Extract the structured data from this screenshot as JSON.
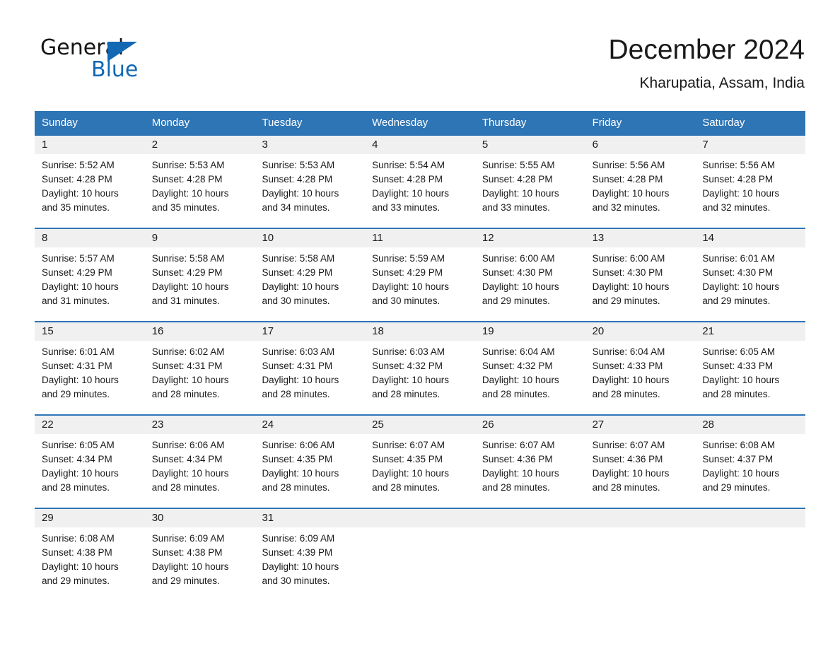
{
  "brand": {
    "word1": "General",
    "word2": "Blue",
    "triangle_color": "#1268b3",
    "text_color": "#161616"
  },
  "header": {
    "title": "December 2024",
    "subtitle": "Kharupatia, Assam, India"
  },
  "theme": {
    "header_blue": "#2e75b6",
    "date_band_gray": "#f0f0f0",
    "text_black": "#1a1a1a",
    "white": "#ffffff"
  },
  "weekdays": [
    "Sunday",
    "Monday",
    "Tuesday",
    "Wednesday",
    "Thursday",
    "Friday",
    "Saturday"
  ],
  "weeks": [
    {
      "days": [
        {
          "num": "1",
          "sunrise": "Sunrise: 5:52 AM",
          "sunset": "Sunset: 4:28 PM",
          "daylight1": "Daylight: 10 hours",
          "daylight2": "and 35 minutes."
        },
        {
          "num": "2",
          "sunrise": "Sunrise: 5:53 AM",
          "sunset": "Sunset: 4:28 PM",
          "daylight1": "Daylight: 10 hours",
          "daylight2": "and 35 minutes."
        },
        {
          "num": "3",
          "sunrise": "Sunrise: 5:53 AM",
          "sunset": "Sunset: 4:28 PM",
          "daylight1": "Daylight: 10 hours",
          "daylight2": "and 34 minutes."
        },
        {
          "num": "4",
          "sunrise": "Sunrise: 5:54 AM",
          "sunset": "Sunset: 4:28 PM",
          "daylight1": "Daylight: 10 hours",
          "daylight2": "and 33 minutes."
        },
        {
          "num": "5",
          "sunrise": "Sunrise: 5:55 AM",
          "sunset": "Sunset: 4:28 PM",
          "daylight1": "Daylight: 10 hours",
          "daylight2": "and 33 minutes."
        },
        {
          "num": "6",
          "sunrise": "Sunrise: 5:56 AM",
          "sunset": "Sunset: 4:28 PM",
          "daylight1": "Daylight: 10 hours",
          "daylight2": "and 32 minutes."
        },
        {
          "num": "7",
          "sunrise": "Sunrise: 5:56 AM",
          "sunset": "Sunset: 4:28 PM",
          "daylight1": "Daylight: 10 hours",
          "daylight2": "and 32 minutes."
        }
      ]
    },
    {
      "days": [
        {
          "num": "8",
          "sunrise": "Sunrise: 5:57 AM",
          "sunset": "Sunset: 4:29 PM",
          "daylight1": "Daylight: 10 hours",
          "daylight2": "and 31 minutes."
        },
        {
          "num": "9",
          "sunrise": "Sunrise: 5:58 AM",
          "sunset": "Sunset: 4:29 PM",
          "daylight1": "Daylight: 10 hours",
          "daylight2": "and 31 minutes."
        },
        {
          "num": "10",
          "sunrise": "Sunrise: 5:58 AM",
          "sunset": "Sunset: 4:29 PM",
          "daylight1": "Daylight: 10 hours",
          "daylight2": "and 30 minutes."
        },
        {
          "num": "11",
          "sunrise": "Sunrise: 5:59 AM",
          "sunset": "Sunset: 4:29 PM",
          "daylight1": "Daylight: 10 hours",
          "daylight2": "and 30 minutes."
        },
        {
          "num": "12",
          "sunrise": "Sunrise: 6:00 AM",
          "sunset": "Sunset: 4:30 PM",
          "daylight1": "Daylight: 10 hours",
          "daylight2": "and 29 minutes."
        },
        {
          "num": "13",
          "sunrise": "Sunrise: 6:00 AM",
          "sunset": "Sunset: 4:30 PM",
          "daylight1": "Daylight: 10 hours",
          "daylight2": "and 29 minutes."
        },
        {
          "num": "14",
          "sunrise": "Sunrise: 6:01 AM",
          "sunset": "Sunset: 4:30 PM",
          "daylight1": "Daylight: 10 hours",
          "daylight2": "and 29 minutes."
        }
      ]
    },
    {
      "days": [
        {
          "num": "15",
          "sunrise": "Sunrise: 6:01 AM",
          "sunset": "Sunset: 4:31 PM",
          "daylight1": "Daylight: 10 hours",
          "daylight2": "and 29 minutes."
        },
        {
          "num": "16",
          "sunrise": "Sunrise: 6:02 AM",
          "sunset": "Sunset: 4:31 PM",
          "daylight1": "Daylight: 10 hours",
          "daylight2": "and 28 minutes."
        },
        {
          "num": "17",
          "sunrise": "Sunrise: 6:03 AM",
          "sunset": "Sunset: 4:31 PM",
          "daylight1": "Daylight: 10 hours",
          "daylight2": "and 28 minutes."
        },
        {
          "num": "18",
          "sunrise": "Sunrise: 6:03 AM",
          "sunset": "Sunset: 4:32 PM",
          "daylight1": "Daylight: 10 hours",
          "daylight2": "and 28 minutes."
        },
        {
          "num": "19",
          "sunrise": "Sunrise: 6:04 AM",
          "sunset": "Sunset: 4:32 PM",
          "daylight1": "Daylight: 10 hours",
          "daylight2": "and 28 minutes."
        },
        {
          "num": "20",
          "sunrise": "Sunrise: 6:04 AM",
          "sunset": "Sunset: 4:33 PM",
          "daylight1": "Daylight: 10 hours",
          "daylight2": "and 28 minutes."
        },
        {
          "num": "21",
          "sunrise": "Sunrise: 6:05 AM",
          "sunset": "Sunset: 4:33 PM",
          "daylight1": "Daylight: 10 hours",
          "daylight2": "and 28 minutes."
        }
      ]
    },
    {
      "days": [
        {
          "num": "22",
          "sunrise": "Sunrise: 6:05 AM",
          "sunset": "Sunset: 4:34 PM",
          "daylight1": "Daylight: 10 hours",
          "daylight2": "and 28 minutes."
        },
        {
          "num": "23",
          "sunrise": "Sunrise: 6:06 AM",
          "sunset": "Sunset: 4:34 PM",
          "daylight1": "Daylight: 10 hours",
          "daylight2": "and 28 minutes."
        },
        {
          "num": "24",
          "sunrise": "Sunrise: 6:06 AM",
          "sunset": "Sunset: 4:35 PM",
          "daylight1": "Daylight: 10 hours",
          "daylight2": "and 28 minutes."
        },
        {
          "num": "25",
          "sunrise": "Sunrise: 6:07 AM",
          "sunset": "Sunset: 4:35 PM",
          "daylight1": "Daylight: 10 hours",
          "daylight2": "and 28 minutes."
        },
        {
          "num": "26",
          "sunrise": "Sunrise: 6:07 AM",
          "sunset": "Sunset: 4:36 PM",
          "daylight1": "Daylight: 10 hours",
          "daylight2": "and 28 minutes."
        },
        {
          "num": "27",
          "sunrise": "Sunrise: 6:07 AM",
          "sunset": "Sunset: 4:36 PM",
          "daylight1": "Daylight: 10 hours",
          "daylight2": "and 28 minutes."
        },
        {
          "num": "28",
          "sunrise": "Sunrise: 6:08 AM",
          "sunset": "Sunset: 4:37 PM",
          "daylight1": "Daylight: 10 hours",
          "daylight2": "and 29 minutes."
        }
      ]
    },
    {
      "days": [
        {
          "num": "29",
          "sunrise": "Sunrise: 6:08 AM",
          "sunset": "Sunset: 4:38 PM",
          "daylight1": "Daylight: 10 hours",
          "daylight2": "and 29 minutes."
        },
        {
          "num": "30",
          "sunrise": "Sunrise: 6:09 AM",
          "sunset": "Sunset: 4:38 PM",
          "daylight1": "Daylight: 10 hours",
          "daylight2": "and 29 minutes."
        },
        {
          "num": "31",
          "sunrise": "Sunrise: 6:09 AM",
          "sunset": "Sunset: 4:39 PM",
          "daylight1": "Daylight: 10 hours",
          "daylight2": "and 30 minutes."
        },
        {
          "num": "",
          "sunrise": "",
          "sunset": "",
          "daylight1": "",
          "daylight2": ""
        },
        {
          "num": "",
          "sunrise": "",
          "sunset": "",
          "daylight1": "",
          "daylight2": ""
        },
        {
          "num": "",
          "sunrise": "",
          "sunset": "",
          "daylight1": "",
          "daylight2": ""
        },
        {
          "num": "",
          "sunrise": "",
          "sunset": "",
          "daylight1": "",
          "daylight2": ""
        }
      ]
    }
  ]
}
